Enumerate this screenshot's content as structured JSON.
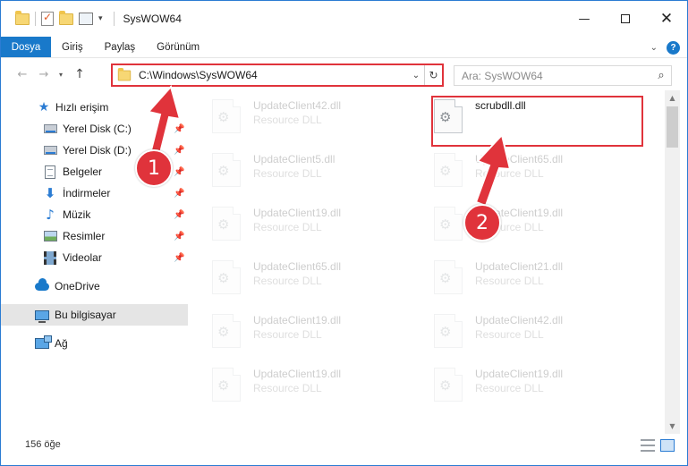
{
  "window": {
    "title": "SysWOW64",
    "minimize_glyph": "—",
    "close_glyph": "✕"
  },
  "ribbon": {
    "tabs": [
      {
        "label": "Dosya",
        "active": true
      },
      {
        "label": "Giriş"
      },
      {
        "label": "Paylaş"
      },
      {
        "label": "Görünüm"
      }
    ],
    "help_glyph": "?"
  },
  "address": {
    "path": "C:\\Windows\\SysWOW64",
    "back_glyph": "←",
    "forward_glyph": "→",
    "up_glyph": "↑",
    "refresh_glyph": "↻"
  },
  "search": {
    "placeholder": "Ara: SysWOW64"
  },
  "navpane": {
    "items": [
      {
        "label": "Hızlı erişim",
        "icon": "star-icon"
      },
      {
        "label": "Yerel Disk (C:)",
        "icon": "drive-icon",
        "pinned": true
      },
      {
        "label": "Yerel Disk (D:)",
        "icon": "drive-icon",
        "pinned": true
      },
      {
        "label": "Belgeler",
        "icon": "documents-icon",
        "pinned": true
      },
      {
        "label": "İndirmeler",
        "icon": "downloads-icon",
        "pinned": true
      },
      {
        "label": "Müzik",
        "icon": "music-icon",
        "pinned": true
      },
      {
        "label": "Resimler",
        "icon": "pictures-icon",
        "pinned": true
      },
      {
        "label": "Videolar",
        "icon": "videos-icon",
        "pinned": true
      },
      {
        "label": "OneDrive",
        "icon": "onedrive-icon"
      },
      {
        "label": "Bu bilgisayar",
        "icon": "this-pc-icon",
        "selected": true
      },
      {
        "label": "Ağ",
        "icon": "network-icon"
      }
    ]
  },
  "files": [
    {
      "name": "UpdateClient42.dll",
      "type": "Resource DLL",
      "faded": true
    },
    {
      "name": "scrubdll.dll",
      "type": "",
      "faded": false,
      "highlighted": true
    },
    {
      "name": "UpdateClient5.dll",
      "type": "Resource DLL",
      "faded": true
    },
    {
      "name": "UpdateClient65.dll",
      "type": "Resource DLL",
      "faded": true
    },
    {
      "name": "UpdateClient19.dll",
      "type": "Resource DLL",
      "faded": true
    },
    {
      "name": "UpdateClient19.dll",
      "type": "Resource DLL",
      "faded": true
    },
    {
      "name": "UpdateClient65.dll",
      "type": "Resource DLL",
      "faded": true
    },
    {
      "name": "UpdateClient21.dll",
      "type": "Resource DLL",
      "faded": true
    },
    {
      "name": "UpdateClient19.dll",
      "type": "Resource DLL",
      "faded": true
    },
    {
      "name": "UpdateClient42.dll",
      "type": "Resource DLL",
      "faded": true
    },
    {
      "name": "UpdateClient19.dll",
      "type": "Resource DLL",
      "faded": true
    },
    {
      "name": "UpdateClient19.dll",
      "type": "Resource DLL",
      "faded": true
    }
  ],
  "status": {
    "item_count": "156 öğe"
  },
  "annotations": {
    "badge_1": "1",
    "badge_2": "2",
    "color": "#e0333b"
  },
  "colors": {
    "accent": "#1979ca",
    "highlight": "#e0333b",
    "selected_bg": "#e5e5e5"
  }
}
